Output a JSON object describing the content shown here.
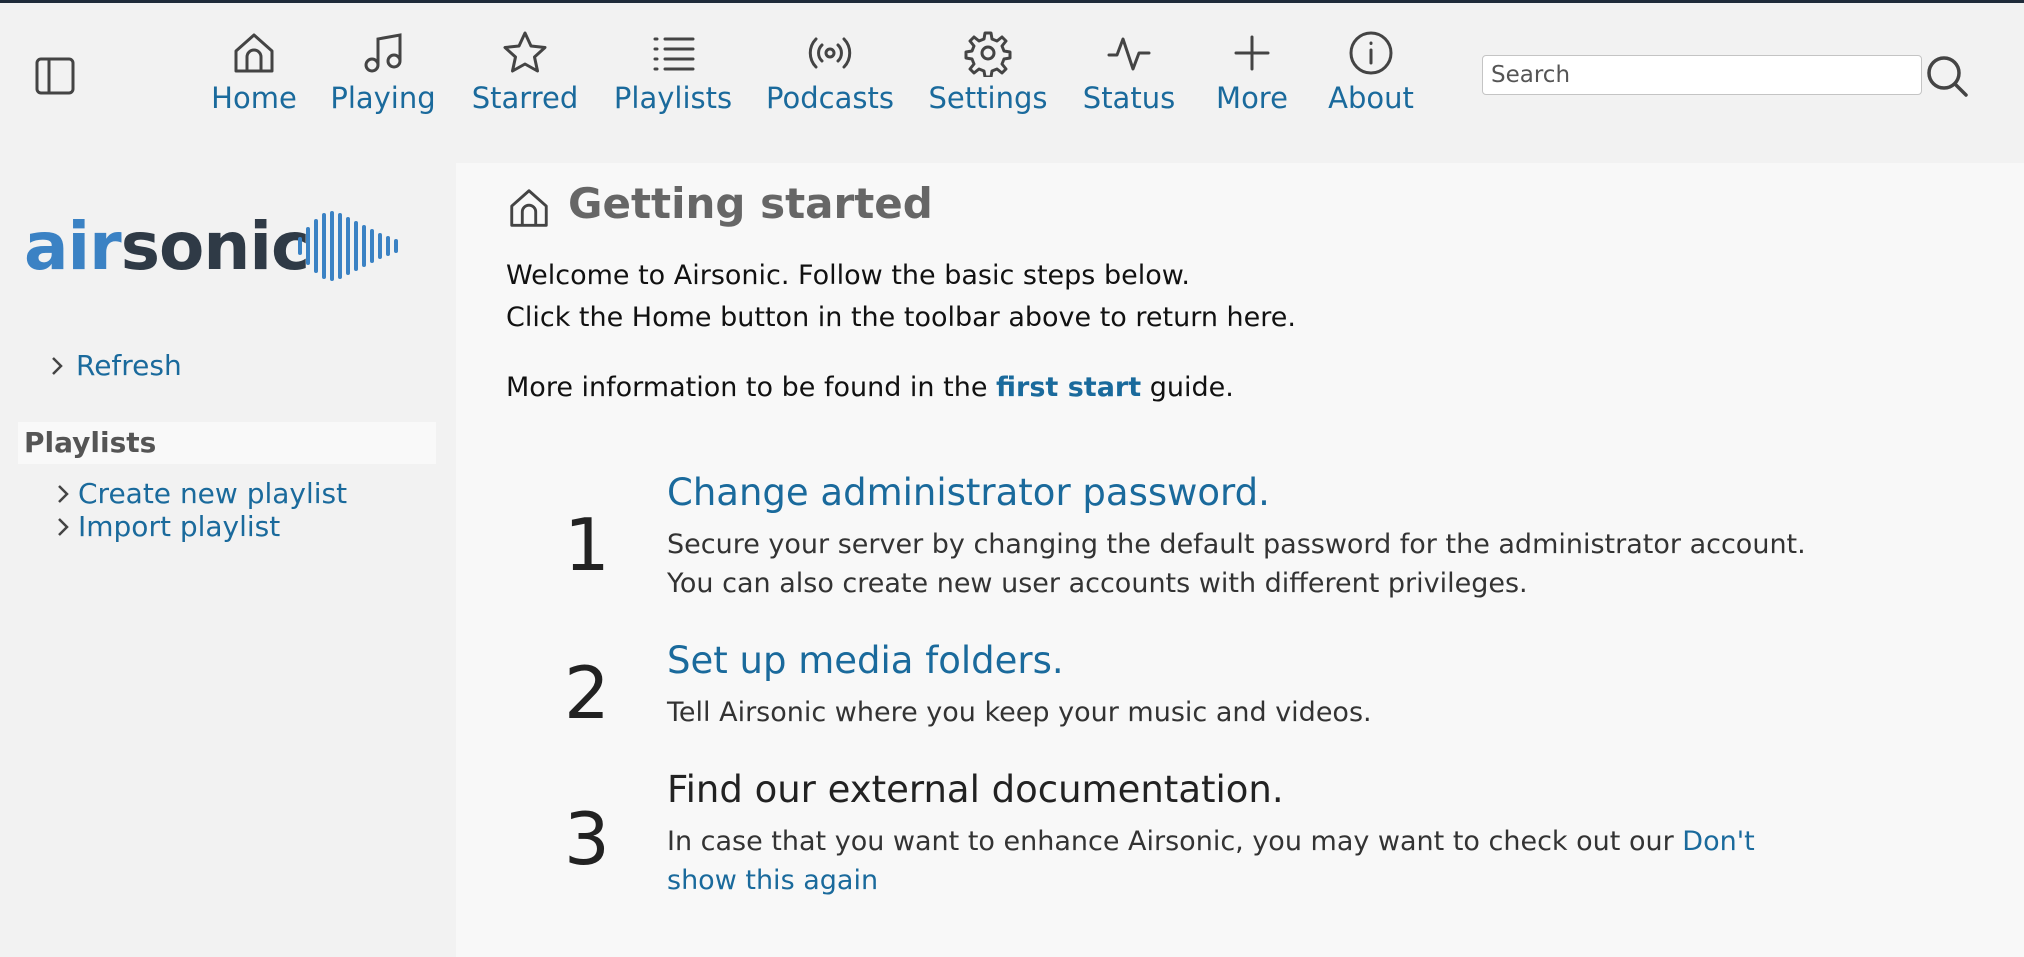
{
  "toolbar": {
    "nav": [
      {
        "label": "Home",
        "icon": "home-icon"
      },
      {
        "label": "Playing",
        "icon": "music-note-icon"
      },
      {
        "label": "Starred",
        "icon": "star-icon"
      },
      {
        "label": "Playlists",
        "icon": "list-icon"
      },
      {
        "label": "Podcasts",
        "icon": "broadcast-icon"
      },
      {
        "label": "Settings",
        "icon": "gear-icon"
      },
      {
        "label": "Status",
        "icon": "activity-icon"
      },
      {
        "label": "More",
        "icon": "plus-icon"
      },
      {
        "label": "About",
        "icon": "info-icon"
      }
    ],
    "search_placeholder": "Search"
  },
  "sidebar": {
    "logo": {
      "part1": "air",
      "part2": "sonic"
    },
    "refresh_label": "Refresh",
    "playlists_heading": "Playlists",
    "create_playlist_label": "Create new playlist",
    "import_playlist_label": "Import playlist"
  },
  "main": {
    "title": "Getting started",
    "intro_line1": "Welcome to Airsonic. Follow the basic steps below.",
    "intro_line2": "Click the Home button in the toolbar above to return here.",
    "info_prefix": "More information to be found in the ",
    "info_link": "first start",
    "info_suffix": " guide.",
    "steps": [
      {
        "number": "1",
        "title": "Change administrator password.",
        "desc": "Secure your server by changing the default password for the administrator account. You can also create new user accounts with different privileges."
      },
      {
        "number": "2",
        "title": "Set up media folders.",
        "desc": "Tell Airsonic where you keep your music and videos."
      },
      {
        "number": "3",
        "title": "Find our external documentation.",
        "desc": "In case that you want to enhance Airsonic, you may want to check out our ",
        "link": "Don't show this again"
      }
    ]
  },
  "colors": {
    "accent": "#1a6a9c",
    "logo_blue": "#3b82c4",
    "logo_dark": "#2f3a46"
  }
}
